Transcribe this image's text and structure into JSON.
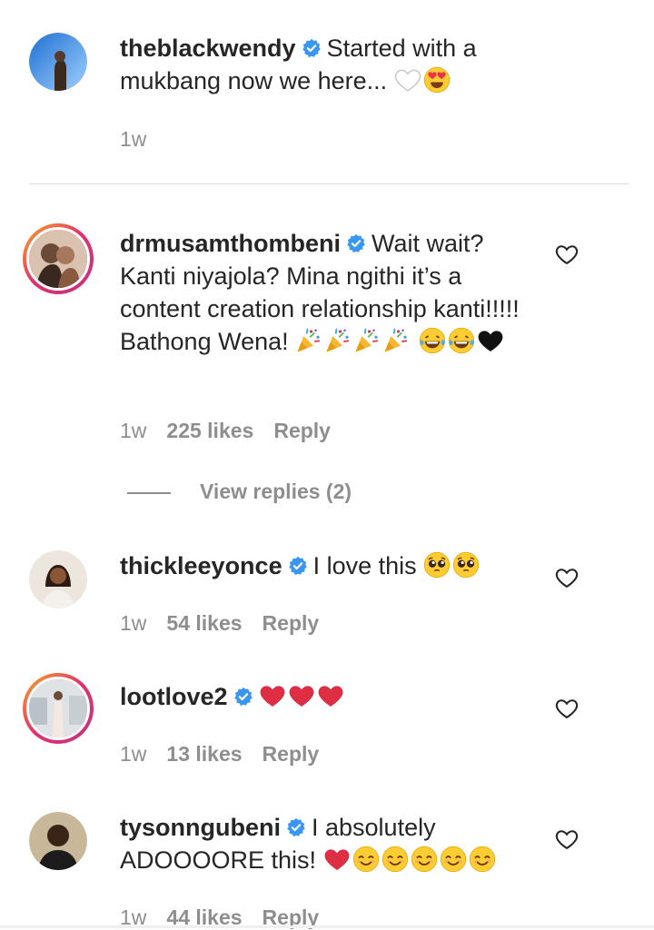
{
  "comments": [
    {
      "username": "theblackwendy",
      "text": "Started with a mukbang now we here...",
      "emojis": [
        "white-heart",
        "heart-eyes"
      ],
      "time": "1w",
      "likes": "",
      "reply": ""
    },
    {
      "username": "drmusamthombeni",
      "text": "Wait wait? Kanti niyajola? Mina ngithi it’s a content creation relationship kanti!!!!! Bathong Wena!",
      "emojis": [
        "party-popper",
        "party-popper",
        "party-popper",
        "party-popper",
        "joy",
        "joy",
        "black-heart"
      ],
      "time": "1w",
      "likes": "225 likes",
      "reply": "Reply"
    },
    {
      "username": "thickleeyonce",
      "text": "I love this",
      "emojis": [
        "pleading",
        "pleading"
      ],
      "time": "1w",
      "likes": "54 likes",
      "reply": "Reply"
    },
    {
      "username": "lootlove2",
      "text": "",
      "emojis": [
        "red-heart",
        "red-heart",
        "red-heart"
      ],
      "time": "1w",
      "likes": "13 likes",
      "reply": "Reply"
    },
    {
      "username": "tysonngubeni",
      "text": "I absolutely ADOOOORE this!",
      "emojis": [
        "red-heart",
        "smile",
        "smile",
        "smile",
        "smile",
        "smile"
      ],
      "time": "1w",
      "likes": "44 likes",
      "reply": "Reply"
    }
  ],
  "view_replies": "View replies (2)",
  "colors": {
    "text": "#262626",
    "muted": "#8e8e8e",
    "verified": "#3897f0",
    "divider": "#dbdbdb"
  }
}
